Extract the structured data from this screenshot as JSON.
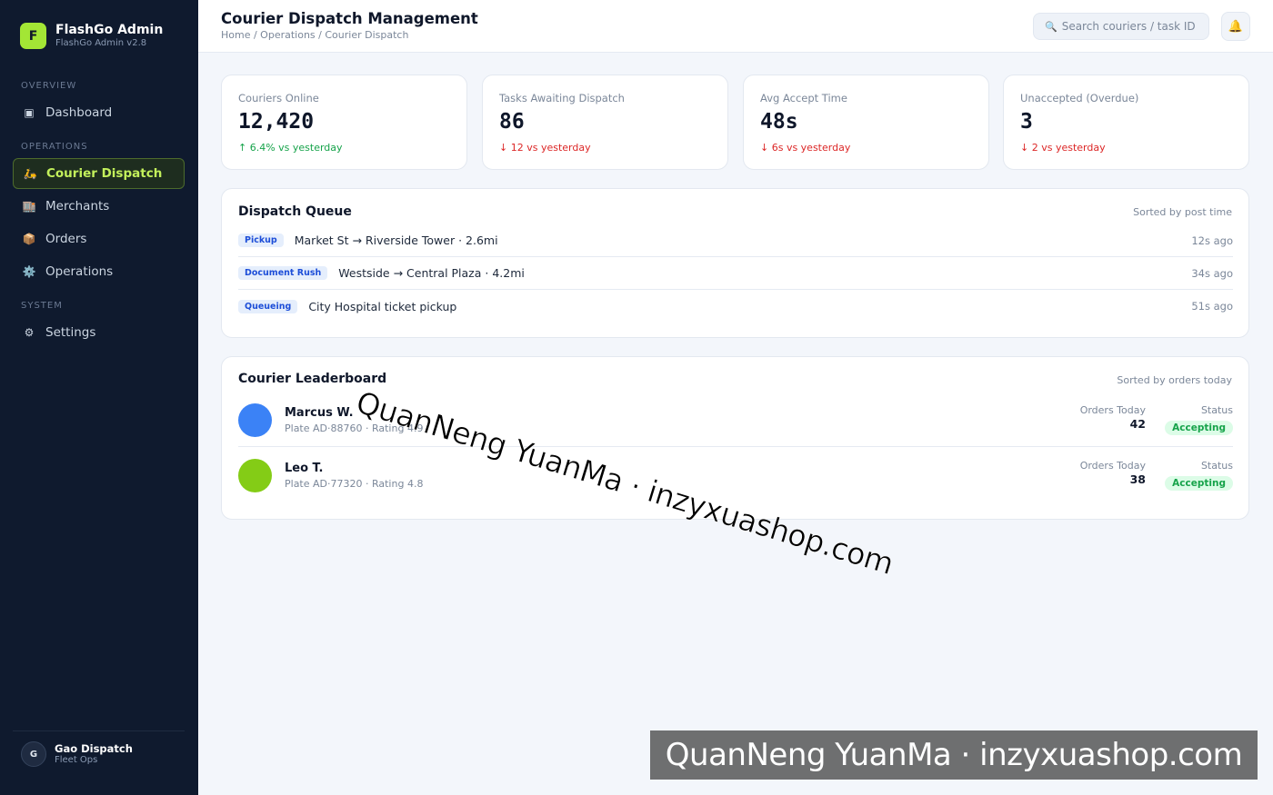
{
  "brand": {
    "logo_letter": "F",
    "name": "FlashGo Admin",
    "version": "FlashGo Admin v2.8"
  },
  "sidebar": {
    "sections": {
      "overview": "OVERVIEW",
      "operations": "OPERATIONS",
      "system": "SYSTEM"
    },
    "items": [
      {
        "icon": "dashboard-icon",
        "glyph": "▣",
        "label": "Dashboard"
      },
      {
        "icon": "scooter-icon",
        "glyph": "🛵",
        "label": "Courier Dispatch",
        "active": true
      },
      {
        "icon": "store-icon",
        "glyph": "🏬",
        "label": "Merchants"
      },
      {
        "icon": "package-icon",
        "glyph": "📦",
        "label": "Orders"
      },
      {
        "icon": "gear-icon",
        "glyph": "⚙️",
        "label": "Operations"
      },
      {
        "icon": "settings-icon",
        "glyph": "⚙",
        "label": "Settings"
      }
    ]
  },
  "user": {
    "initial": "G",
    "name": "Gao Dispatch",
    "role": "Fleet Ops"
  },
  "header": {
    "title": "Courier Dispatch Management",
    "breadcrumb": "Home / Operations / Courier Dispatch",
    "search_placeholder": "Search couriers / task ID"
  },
  "stats": [
    {
      "label": "Couriers Online",
      "value": "12,420",
      "delta": "↑ 6.4% vs yesterday",
      "trend": "up"
    },
    {
      "label": "Tasks Awaiting Dispatch",
      "value": "86",
      "delta": "↓ 12 vs yesterday",
      "trend": "down"
    },
    {
      "label": "Avg Accept Time",
      "value": "48s",
      "delta": "↓ 6s vs yesterday",
      "trend": "down"
    },
    {
      "label": "Unaccepted (Overdue)",
      "value": "3",
      "delta": "↓ 2 vs yesterday",
      "trend": "down"
    }
  ],
  "queue": {
    "title": "Dispatch Queue",
    "note": "Sorted by post time",
    "rows": [
      {
        "tag": "Pickup",
        "text": "Market St → Riverside Tower · 2.6mi",
        "time": "12s ago"
      },
      {
        "tag": "Document Rush",
        "text": "Westside → Central Plaza · 4.2mi",
        "time": "34s ago"
      },
      {
        "tag": "Queueing",
        "text": "City Hospital ticket pickup",
        "time": "51s ago"
      }
    ]
  },
  "leaderboard": {
    "title": "Courier Leaderboard",
    "note": "Sorted by orders today",
    "rows": [
      {
        "name": "Marcus W.",
        "sub": "Plate AD·88760 · Rating 4.9",
        "orders_label": "Orders Today",
        "orders": "42",
        "status_label": "Status",
        "status": "Accepting",
        "avatar_color": "#3b82f6"
      },
      {
        "name": "Leo T.",
        "sub": "Plate AD·77320 · Rating 4.8",
        "orders_label": "Orders Today",
        "orders": "38",
        "status_label": "Status",
        "status": "Accepting",
        "avatar_color": "#84cc16"
      }
    ]
  },
  "watermark": "QuanNeng YuanMa · inzyxuashop.com",
  "colors": {
    "accent": "#a3e635",
    "sidebar_bg": "#0f1a2e",
    "up": "#16a34a",
    "down": "#dc2626"
  }
}
